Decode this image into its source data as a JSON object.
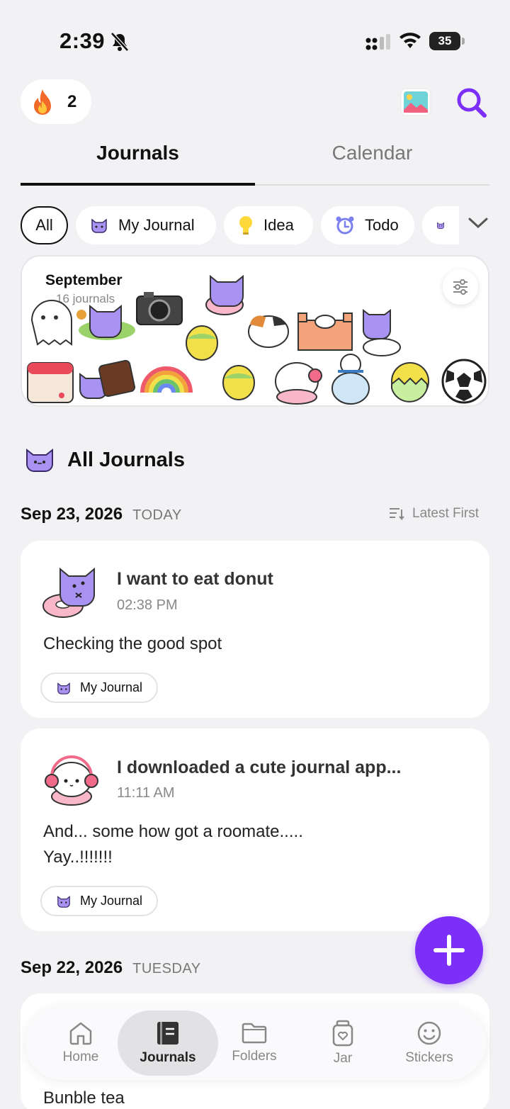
{
  "status_bar": {
    "time": "2:39",
    "battery": "35"
  },
  "header": {
    "streak_count": "2"
  },
  "tabs": [
    {
      "label": "Journals",
      "active": true
    },
    {
      "label": "Calendar",
      "active": false
    }
  ],
  "filters": [
    {
      "label": "All",
      "selected": true
    },
    {
      "label": "My Journal",
      "icon": "cat-icon"
    },
    {
      "label": "Idea",
      "icon": "lightbulb-icon"
    },
    {
      "label": "Todo",
      "icon": "alarm-clock-icon"
    }
  ],
  "banner": {
    "month": "September",
    "count": "16 journals"
  },
  "section": {
    "title": "All Journals"
  },
  "groups": [
    {
      "date": "Sep 23, 2026",
      "day": "TODAY",
      "sort_label": "Latest First",
      "entries": [
        {
          "title": "I want to eat donut",
          "time": "02:38 PM",
          "body": "Checking the good spot",
          "tag": "My Journal"
        },
        {
          "title": "I downloaded a cute journal app...",
          "time": "11:11 AM",
          "body": "And... some how got a roomate.....\nYay..!!!!!!!",
          "tag": "My Journal"
        }
      ]
    },
    {
      "date": "Sep 22, 2026",
      "day": "TUESDAY",
      "entries": [
        {
          "body": "Bunble tea"
        }
      ]
    }
  ],
  "bottom_nav": [
    {
      "label": "Home",
      "icon": "home-icon"
    },
    {
      "label": "Journals",
      "icon": "journal-icon",
      "active": true
    },
    {
      "label": "Folders",
      "icon": "folder-icon"
    },
    {
      "label": "Jar",
      "icon": "jar-icon"
    },
    {
      "label": "Stickers",
      "icon": "smiley-icon"
    }
  ],
  "colors": {
    "accent": "#7b2ff7",
    "background": "#f2f2f5",
    "cat_purple": "#a993f2"
  }
}
